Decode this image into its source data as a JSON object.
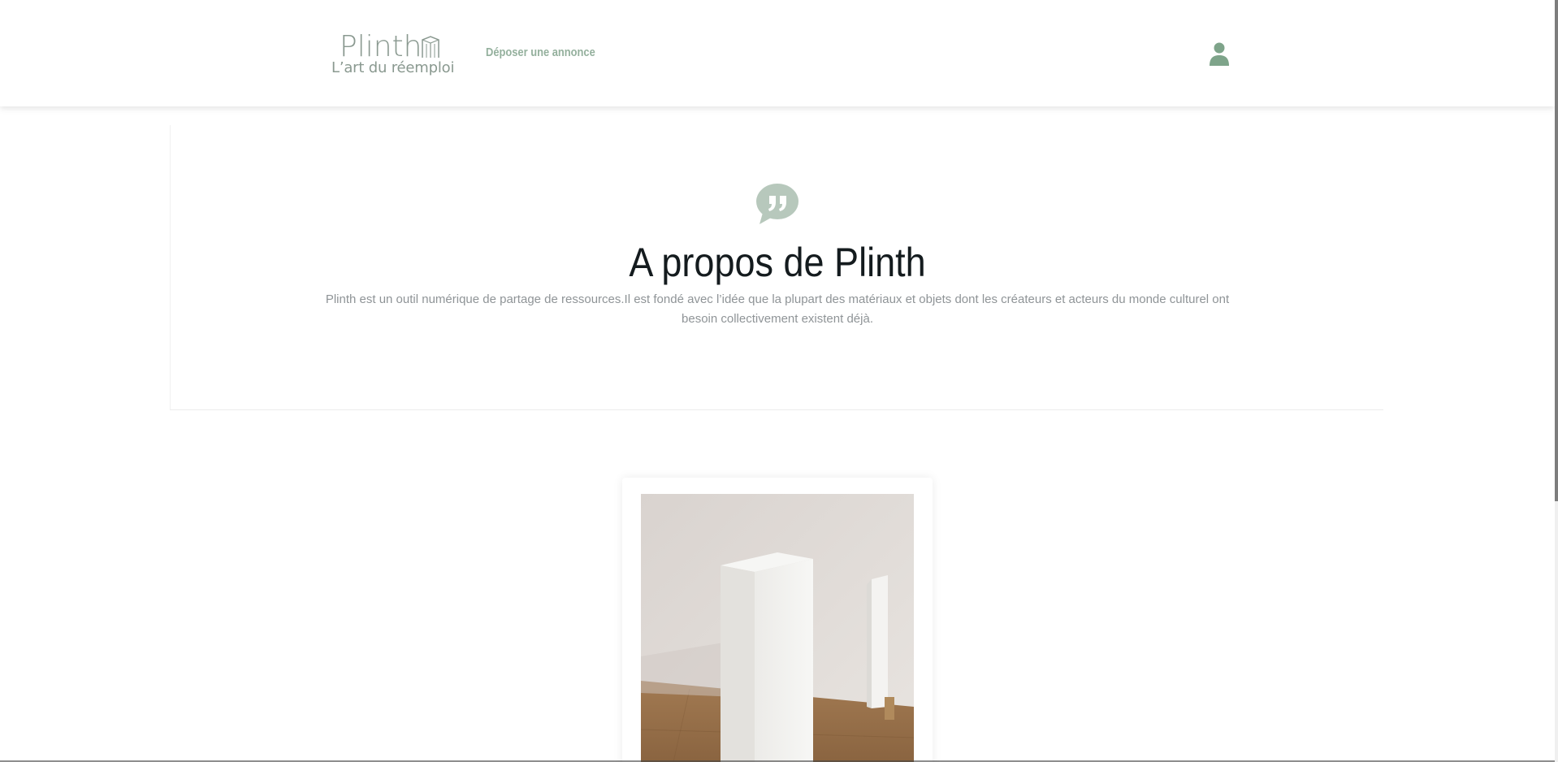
{
  "header": {
    "logo_word": "Plinth",
    "logo_tagline": "L’art du réemploi",
    "nav_post_ad": "Déposer une annonce",
    "icons": {
      "building": "logo-building-icon",
      "user": "user-icon"
    }
  },
  "about": {
    "icon": "speech-bubble-quote-icon",
    "title": "A propos de Plinth",
    "text": "Plinth est un outil numérique de partage de ressources.Il est fondé avec l’idée que la plupart des matériaux et objets dont les créateurs et acteurs du monde culturel ont besoin collectivement existent déjà."
  },
  "listing": {
    "image_description": "white-pedestals-photo"
  },
  "colors": {
    "accent_green": "#94b09d",
    "logo_gray": "#8a9990",
    "title_dark": "#141b1e",
    "body_gray": "#8f9497",
    "quote_icon": "#b7c8bc",
    "user_icon": "#7ea48a"
  }
}
